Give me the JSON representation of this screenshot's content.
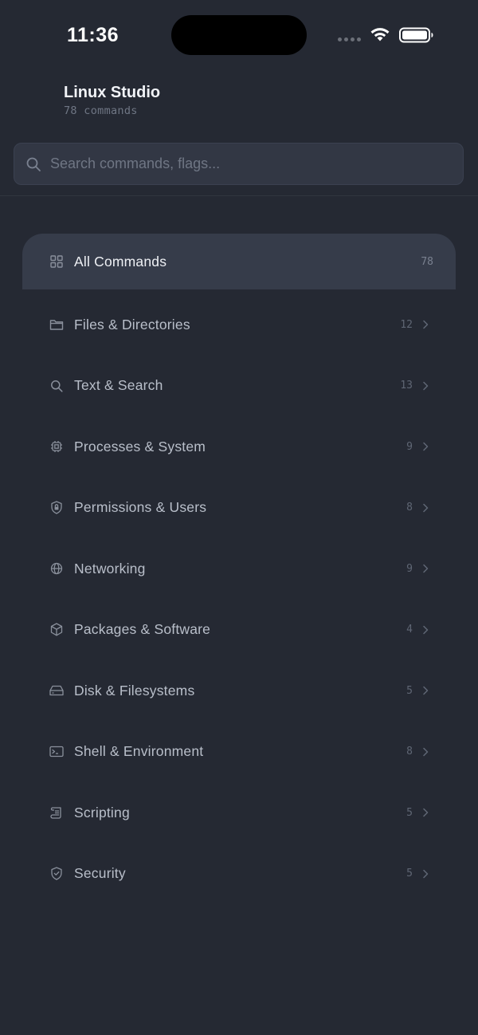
{
  "status_bar": {
    "time": "11:36"
  },
  "header": {
    "title": "Linux Studio",
    "subtitle": "78 commands"
  },
  "search": {
    "placeholder": "Search commands, flags..."
  },
  "categories": [
    {
      "label": "All Commands",
      "count": "78",
      "icon": "grid-icon",
      "active": true
    },
    {
      "label": "Files & Directories",
      "count": "12",
      "icon": "folder-icon"
    },
    {
      "label": "Text & Search",
      "count": "13",
      "icon": "search-icon"
    },
    {
      "label": "Processes & System",
      "count": "9",
      "icon": "cpu-icon"
    },
    {
      "label": "Permissions & Users",
      "count": "8",
      "icon": "lock-shield-icon"
    },
    {
      "label": "Networking",
      "count": "9",
      "icon": "globe-icon"
    },
    {
      "label": "Packages & Software",
      "count": "4",
      "icon": "package-icon"
    },
    {
      "label": "Disk & Filesystems",
      "count": "5",
      "icon": "hard-drive-icon"
    },
    {
      "label": "Shell & Environment",
      "count": "8",
      "icon": "terminal-icon"
    },
    {
      "label": "Scripting",
      "count": "5",
      "icon": "scroll-icon"
    },
    {
      "label": "Security",
      "count": "5",
      "icon": "shield-check-icon"
    }
  ],
  "colors": {
    "background": "#252933",
    "active_row": "#363c4a",
    "text": "#b9bfca",
    "muted": "#5f6674"
  }
}
